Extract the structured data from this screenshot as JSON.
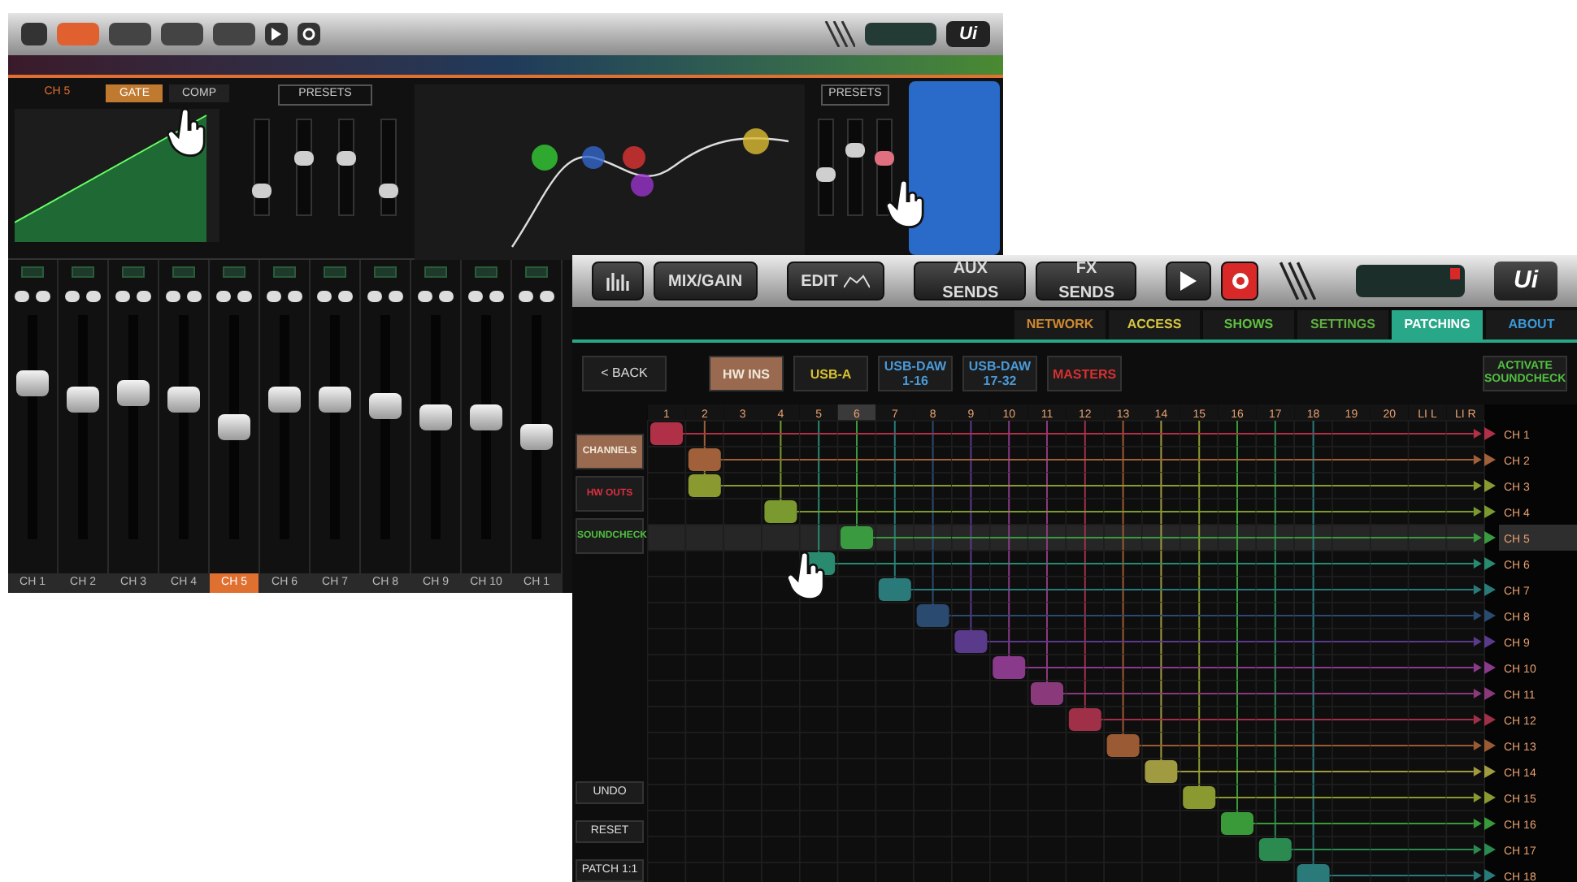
{
  "mixer_screen": {
    "logo": "Ui",
    "dynamics": {
      "channel": "CH 5",
      "tabs": [
        {
          "label": "GATE",
          "selected": true
        },
        {
          "label": "COMP",
          "selected": false
        }
      ],
      "presets": "PRESETS"
    },
    "eq": {
      "presets": "PRESETS"
    },
    "channels": [
      {
        "name": "CH 1",
        "selected": false,
        "level": 0.72
      },
      {
        "name": "CH 2",
        "selected": false,
        "level": 0.64
      },
      {
        "name": "CH 3",
        "selected": false,
        "level": 0.67
      },
      {
        "name": "CH 4",
        "selected": false,
        "level": 0.64
      },
      {
        "name": "CH 5",
        "selected": true,
        "level": 0.5
      },
      {
        "name": "CH 6",
        "selected": false,
        "level": 0.64
      },
      {
        "name": "CH 7",
        "selected": false,
        "level": 0.64
      },
      {
        "name": "CH 8",
        "selected": false,
        "level": 0.61
      },
      {
        "name": "CH 9",
        "selected": false,
        "level": 0.55
      },
      {
        "name": "CH 10",
        "selected": false,
        "level": 0.55
      },
      {
        "name": "CH 1",
        "selected": false,
        "level": 0.45
      }
    ]
  },
  "patching_screen": {
    "toolbar": [
      {
        "kind": "meters"
      },
      {
        "kind": "text",
        "label": "MIX/GAIN"
      },
      {
        "kind": "edit",
        "label": "EDIT"
      },
      {
        "kind": "text",
        "label": "AUX SENDS"
      },
      {
        "kind": "text",
        "label": "FX SENDS"
      },
      {
        "kind": "play"
      },
      {
        "kind": "record"
      }
    ],
    "logo": "Ui",
    "tabs": [
      {
        "label": "NETWORK",
        "color": "#d08a30",
        "selected": false
      },
      {
        "label": "ACCESS",
        "color": "#d8c840",
        "selected": false
      },
      {
        "label": "SHOWS",
        "color": "#60c040",
        "selected": false
      },
      {
        "label": "SETTINGS",
        "color": "#60b040",
        "selected": false
      },
      {
        "label": "PATCHING",
        "selected": true
      },
      {
        "label": "ABOUT",
        "color": "#3a9ad8",
        "selected": false
      }
    ],
    "back": "< BACK",
    "sources": [
      {
        "label": "HW INS",
        "selected": true
      },
      {
        "label": "USB-A",
        "color": "#d8c030",
        "selected": false
      },
      {
        "label": "USB-DAW 1-16",
        "color": "#4a9ad8",
        "selected": false
      },
      {
        "label": "USB-DAW 17-32",
        "color": "#4a9ad8",
        "selected": false
      },
      {
        "label": "MASTERS",
        "color": "#d83030",
        "selected": false
      }
    ],
    "activate": "ACTIVATE SOUNDCHECK",
    "destinations": [
      {
        "label": "CHANNELS",
        "selected": true
      },
      {
        "label": "HW OUTS",
        "color": "#d83040",
        "selected": false
      },
      {
        "label": "SOUNDCHECK",
        "color": "#50c040",
        "selected": false
      }
    ],
    "actions": [
      "UNDO",
      "RESET",
      "PATCH 1:1"
    ],
    "columns": [
      {
        "label": "1",
        "selected": false
      },
      {
        "label": "2",
        "selected": false
      },
      {
        "label": "3",
        "selected": false
      },
      {
        "label": "4",
        "selected": false
      },
      {
        "label": "5",
        "selected": false
      },
      {
        "label": "6",
        "selected": true
      },
      {
        "label": "7",
        "selected": false
      },
      {
        "label": "8",
        "selected": false
      },
      {
        "label": "9",
        "selected": false
      },
      {
        "label": "10",
        "selected": false
      },
      {
        "label": "11",
        "selected": false
      },
      {
        "label": "12",
        "selected": false
      },
      {
        "label": "13",
        "selected": false
      },
      {
        "label": "14",
        "selected": false
      },
      {
        "label": "15",
        "selected": false
      },
      {
        "label": "16",
        "selected": false
      },
      {
        "label": "17",
        "selected": false
      },
      {
        "label": "18",
        "selected": false
      },
      {
        "label": "19",
        "selected": false
      },
      {
        "label": "20",
        "selected": false
      },
      {
        "label": "LI L",
        "selected": false
      },
      {
        "label": "LI R",
        "selected": false
      }
    ],
    "rows": [
      {
        "label": "CH 1",
        "color": "#b03048",
        "selected": false,
        "patched": [
          true,
          false,
          false,
          false,
          false,
          false,
          false,
          false,
          false,
          false,
          false,
          false,
          false,
          false,
          false,
          false,
          false,
          false,
          false,
          false,
          false,
          false
        ]
      },
      {
        "label": "CH 2",
        "color": "#a0603a",
        "selected": false,
        "patched": [
          false,
          true,
          false,
          false,
          false,
          false,
          false,
          false,
          false,
          false,
          false,
          false,
          false,
          false,
          false,
          false,
          false,
          false,
          false,
          false,
          false,
          false
        ]
      },
      {
        "label": "CH 3",
        "color": "#8a9a30",
        "selected": false,
        "patched": [
          false,
          true,
          false,
          false,
          false,
          false,
          false,
          false,
          false,
          false,
          false,
          false,
          false,
          false,
          false,
          false,
          false,
          false,
          false,
          false,
          false,
          false
        ]
      },
      {
        "label": "CH 4",
        "color": "#7a9a30",
        "selected": false,
        "patched": [
          false,
          false,
          false,
          true,
          false,
          false,
          false,
          false,
          false,
          false,
          false,
          false,
          false,
          false,
          false,
          false,
          false,
          false,
          false,
          false,
          false,
          false
        ]
      },
      {
        "label": "CH 5",
        "color": "#3a9a40",
        "selected": true,
        "patched": [
          false,
          false,
          false,
          false,
          false,
          true,
          false,
          false,
          false,
          false,
          false,
          false,
          false,
          false,
          false,
          false,
          false,
          false,
          false,
          false,
          false,
          false
        ]
      },
      {
        "label": "CH 6",
        "color": "#2a8a70",
        "selected": false,
        "patched": [
          false,
          false,
          false,
          false,
          true,
          false,
          false,
          false,
          false,
          false,
          false,
          false,
          false,
          false,
          false,
          false,
          false,
          false,
          false,
          false,
          false,
          false
        ]
      },
      {
        "label": "CH 7",
        "color": "#2a7a7a",
        "selected": false,
        "patched": [
          false,
          false,
          false,
          false,
          false,
          false,
          true,
          false,
          false,
          false,
          false,
          false,
          false,
          false,
          false,
          false,
          false,
          false,
          false,
          false,
          false,
          false
        ]
      },
      {
        "label": "CH 8",
        "color": "#2a4a70",
        "selected": false,
        "patched": [
          false,
          false,
          false,
          false,
          false,
          false,
          false,
          true,
          false,
          false,
          false,
          false,
          false,
          false,
          false,
          false,
          false,
          false,
          false,
          false,
          false,
          false
        ]
      },
      {
        "label": "CH 9",
        "color": "#5a3a8a",
        "selected": false,
        "patched": [
          false,
          false,
          false,
          false,
          false,
          false,
          false,
          false,
          true,
          false,
          false,
          false,
          false,
          false,
          false,
          false,
          false,
          false,
          false,
          false,
          false,
          false
        ]
      },
      {
        "label": "CH 10",
        "color": "#8a3a8a",
        "selected": false,
        "patched": [
          false,
          false,
          false,
          false,
          false,
          false,
          false,
          false,
          false,
          true,
          false,
          false,
          false,
          false,
          false,
          false,
          false,
          false,
          false,
          false,
          false,
          false
        ]
      },
      {
        "label": "CH 11",
        "color": "#8a3a7a",
        "selected": false,
        "patched": [
          false,
          false,
          false,
          false,
          false,
          false,
          false,
          false,
          false,
          false,
          true,
          false,
          false,
          false,
          false,
          false,
          false,
          false,
          false,
          false,
          false,
          false
        ]
      },
      {
        "label": "CH 12",
        "color": "#a03048",
        "selected": false,
        "patched": [
          false,
          false,
          false,
          false,
          false,
          false,
          false,
          false,
          false,
          false,
          false,
          true,
          false,
          false,
          false,
          false,
          false,
          false,
          false,
          false,
          false,
          false
        ]
      },
      {
        "label": "CH 13",
        "color": "#9a5a34",
        "selected": false,
        "patched": [
          false,
          false,
          false,
          false,
          false,
          false,
          false,
          false,
          false,
          false,
          false,
          false,
          true,
          false,
          false,
          false,
          false,
          false,
          false,
          false,
          false,
          false
        ]
      },
      {
        "label": "CH 14",
        "color": "#a09a40",
        "selected": false,
        "patched": [
          false,
          false,
          false,
          false,
          false,
          false,
          false,
          false,
          false,
          false,
          false,
          false,
          false,
          true,
          false,
          false,
          false,
          false,
          false,
          false,
          false,
          false
        ]
      },
      {
        "label": "CH 15",
        "color": "#8a9a30",
        "selected": false,
        "patched": [
          false,
          false,
          false,
          false,
          false,
          false,
          false,
          false,
          false,
          false,
          false,
          false,
          false,
          false,
          true,
          false,
          false,
          false,
          false,
          false,
          false,
          false
        ]
      },
      {
        "label": "CH 16",
        "color": "#3a9a3a",
        "selected": false,
        "patched": [
          false,
          false,
          false,
          false,
          false,
          false,
          false,
          false,
          false,
          false,
          false,
          false,
          false,
          false,
          false,
          true,
          false,
          false,
          false,
          false,
          false,
          false
        ]
      },
      {
        "label": "CH 17",
        "color": "#2a8a50",
        "selected": false,
        "patched": [
          false,
          false,
          false,
          false,
          false,
          false,
          false,
          false,
          false,
          false,
          false,
          false,
          false,
          false,
          false,
          false,
          true,
          false,
          false,
          false,
          false,
          false
        ]
      },
      {
        "label": "CH 18",
        "color": "#2a7a7a",
        "selected": false,
        "patched": [
          false,
          false,
          false,
          false,
          false,
          false,
          false,
          false,
          false,
          false,
          false,
          false,
          false,
          false,
          false,
          false,
          false,
          true,
          false,
          false,
          false,
          false
        ]
      }
    ]
  }
}
